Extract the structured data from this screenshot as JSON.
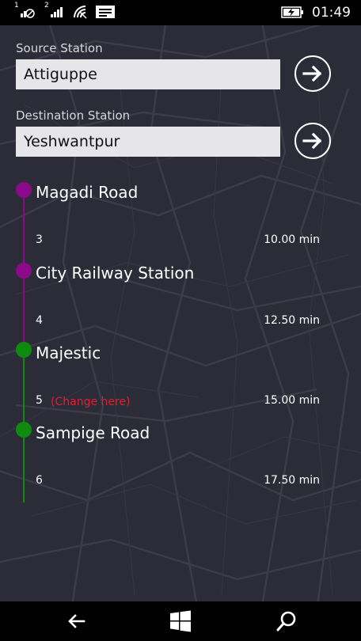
{
  "status_bar": {
    "sim1_label": "1",
    "sim2_label": "2",
    "time": "01:49",
    "icons": [
      "sim1-signal-icon",
      "sim2-signal-icon",
      "wifi-icon",
      "message-icon",
      "battery-charging-icon"
    ]
  },
  "source": {
    "label": "Source Station",
    "value": "Attiguppe"
  },
  "destination": {
    "label": "Destination Station",
    "value": "Yeshwantpur"
  },
  "route": {
    "stations": [
      {
        "name": "Magadi Road",
        "stops": "3",
        "time": "10.00 min",
        "color": "#8b0a8b",
        "note": ""
      },
      {
        "name": "City Railway Station",
        "stops": "4",
        "time": "12.50 min",
        "color": "#8b0a8b",
        "note": ""
      },
      {
        "name": "Majestic",
        "stops": "5",
        "time": "15.00 min",
        "color": "#0e8a0e",
        "note": "(Change here)"
      },
      {
        "name": "Sampige Road",
        "stops": "6",
        "time": "17.50 min",
        "color": "#0e8a0e",
        "note": ""
      }
    ],
    "note_color": "#e02030"
  },
  "nav_bar": {
    "icons": [
      "back-arrow-icon",
      "windows-icon",
      "search-icon"
    ]
  }
}
